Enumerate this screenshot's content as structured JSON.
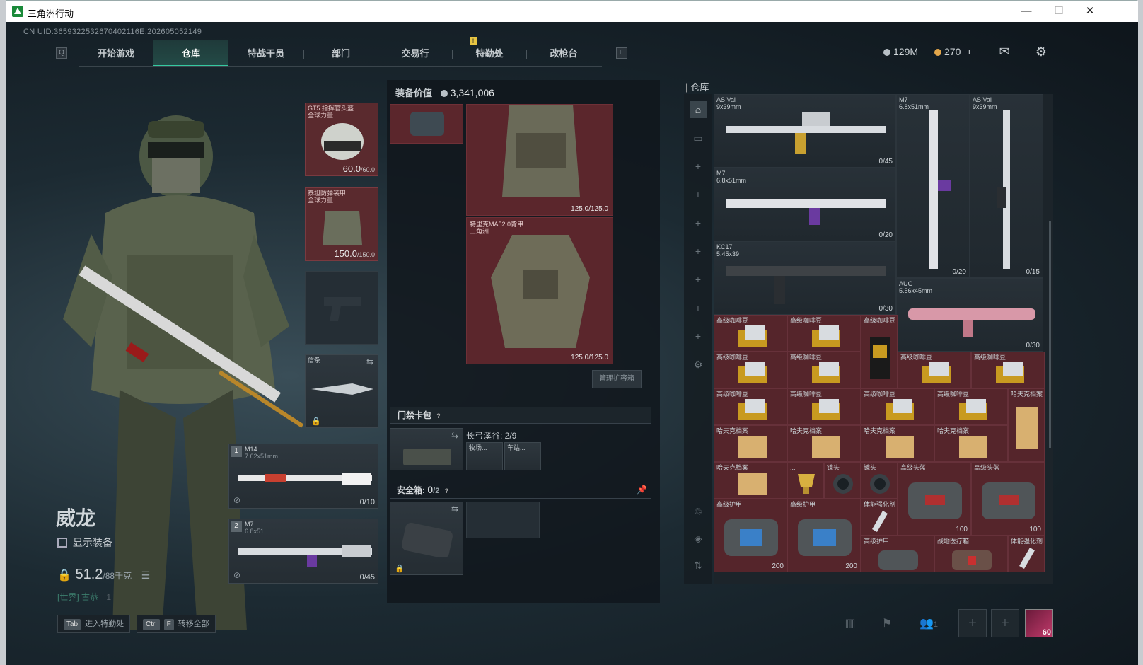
{
  "window": {
    "title": "三角洲行动",
    "minimize": "—",
    "maximize": "☐",
    "close": "✕"
  },
  "uid": "CN UID:3659322532670402116E.202605052149",
  "nav": {
    "left_key": "Q",
    "right_key": "E",
    "tabs": [
      "开始游戏",
      "仓库",
      "特战干员",
      "部门",
      "交易行",
      "特勤处",
      "改枪台"
    ],
    "active_index": 1,
    "alert": "!"
  },
  "currency": {
    "silver": "129M",
    "gold": "270",
    "plus": "+",
    "silver_color": "#b8c0c6",
    "gold_color": "#e3a64a"
  },
  "character": {
    "name": "威龙",
    "show_equipment": "显示装备",
    "weight": "51.2",
    "weight_unit": "/88千克",
    "chat_channel": "[世界]",
    "chat_user": "古恭",
    "chat_count": "1"
  },
  "bottom_buttons": [
    {
      "keys": [
        "Tab"
      ],
      "label": "进入特勤处"
    },
    {
      "keys": [
        "Ctrl",
        "F"
      ],
      "label": "转移全部"
    }
  ],
  "slots": {
    "helmet": {
      "label": "GT5 指挥官头盔",
      "sub": "全球力量",
      "dura": "60.0",
      "max": "/60.0"
    },
    "armor": {
      "label": "泰坦防弹装甲",
      "sub": "全球力量",
      "dura": "150.0",
      "max": "/150.0"
    },
    "melee": {
      "label": "信条"
    },
    "primary": {
      "num": "1",
      "name": "M14",
      "caliber": "7.62x51mm",
      "ammo": "0/10"
    },
    "secondary": {
      "num": "2",
      "name": "M7",
      "caliber": "6.8x51",
      "ammo": "0/45"
    }
  },
  "equipment_panel": {
    "value_label": "装备价值",
    "value": "3,341,006",
    "chest_rig_dura": "125.0/125.0",
    "backpack_label": "特里克MA52.0背甲",
    "backpack_sub": "三角洲",
    "backpack_dura": "125.0/125.0",
    "manage_button": "管理扩容箱",
    "keycard_label": "门禁卡包",
    "keycard_location": "长弓溪谷: 2/9",
    "key_items": [
      "牧场...",
      "车站..."
    ],
    "safebox_label": "安全箱: ",
    "safebox_count": "0",
    "safebox_max": "/2"
  },
  "warehouse": {
    "title": "仓库",
    "guns": [
      {
        "name": "AS Val",
        "caliber": "9x39mm",
        "ammo": "0/45"
      },
      {
        "name": "M7",
        "caliber": "6.8x51mm",
        "ammo": "0/20"
      },
      {
        "name": "KC17",
        "caliber": "5.45x39",
        "ammo": "0/30"
      },
      {
        "name": "M7",
        "caliber": "6.8x51mm",
        "ammo": "0/20"
      },
      {
        "name": "AS Val",
        "caliber": "9x39mm",
        "ammo": "0/15"
      },
      {
        "name": "AUG",
        "caliber": "5.56x45mm",
        "ammo": "0/30"
      }
    ],
    "items": {
      "coffee": "高级咖啡豆",
      "coffee_bag": "高级咖啡豆",
      "cigar": "哈夫克档案",
      "trophy": "...",
      "scope": "镜头",
      "helmet_case": "高级头盔",
      "armor_case": "高级护甲",
      "body_enhance": "体能强化剂",
      "medkit": "战地医疗箱",
      "medkit_small": "战地医疗箱",
      "count_100": "100",
      "count_200": "200"
    }
  },
  "bottom_right": {
    "friend_count": "1",
    "avatar_level": "60"
  }
}
